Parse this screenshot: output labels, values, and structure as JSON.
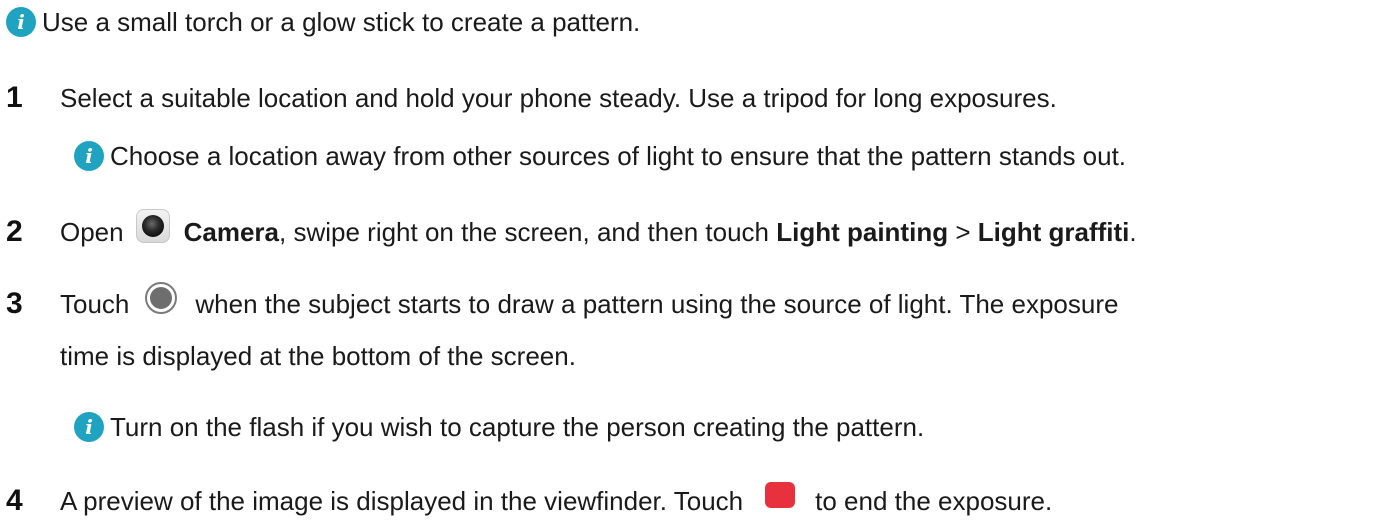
{
  "tip_top": "Use a small torch or a glow stick to create a pattern.",
  "steps": [
    {
      "number": "1",
      "text": "Select a suitable location and hold your phone steady. Use a tripod for long exposures.",
      "tip": "Choose a location away from other sources of light to ensure that the pattern stands out."
    },
    {
      "number": "2",
      "pre": "Open",
      "app_name": "Camera",
      "mid": ", swipe right on the screen, and then touch",
      "mode1": "Light painting",
      "sep": ">",
      "mode2": "Light graffiti",
      "end": ".",
      "icon": "camera-app-icon"
    },
    {
      "number": "3",
      "pre": "Touch",
      "line1": "when the subject starts to draw a pattern using the source of light. The exposure",
      "line2": "time is displayed at the bottom of the screen.",
      "icon": "shutter-button-icon",
      "tip": "Turn on the flash if you wish to capture the person creating the pattern."
    },
    {
      "number": "4",
      "pre": "A preview of the image is displayed in the viewfinder. Touch",
      "post": "to end the exposure.",
      "icon": "stop-button-icon"
    }
  ],
  "colors": {
    "info_icon": "#1fa3c0",
    "stop_button": "#e8313e",
    "text": "#1a1a1a"
  }
}
